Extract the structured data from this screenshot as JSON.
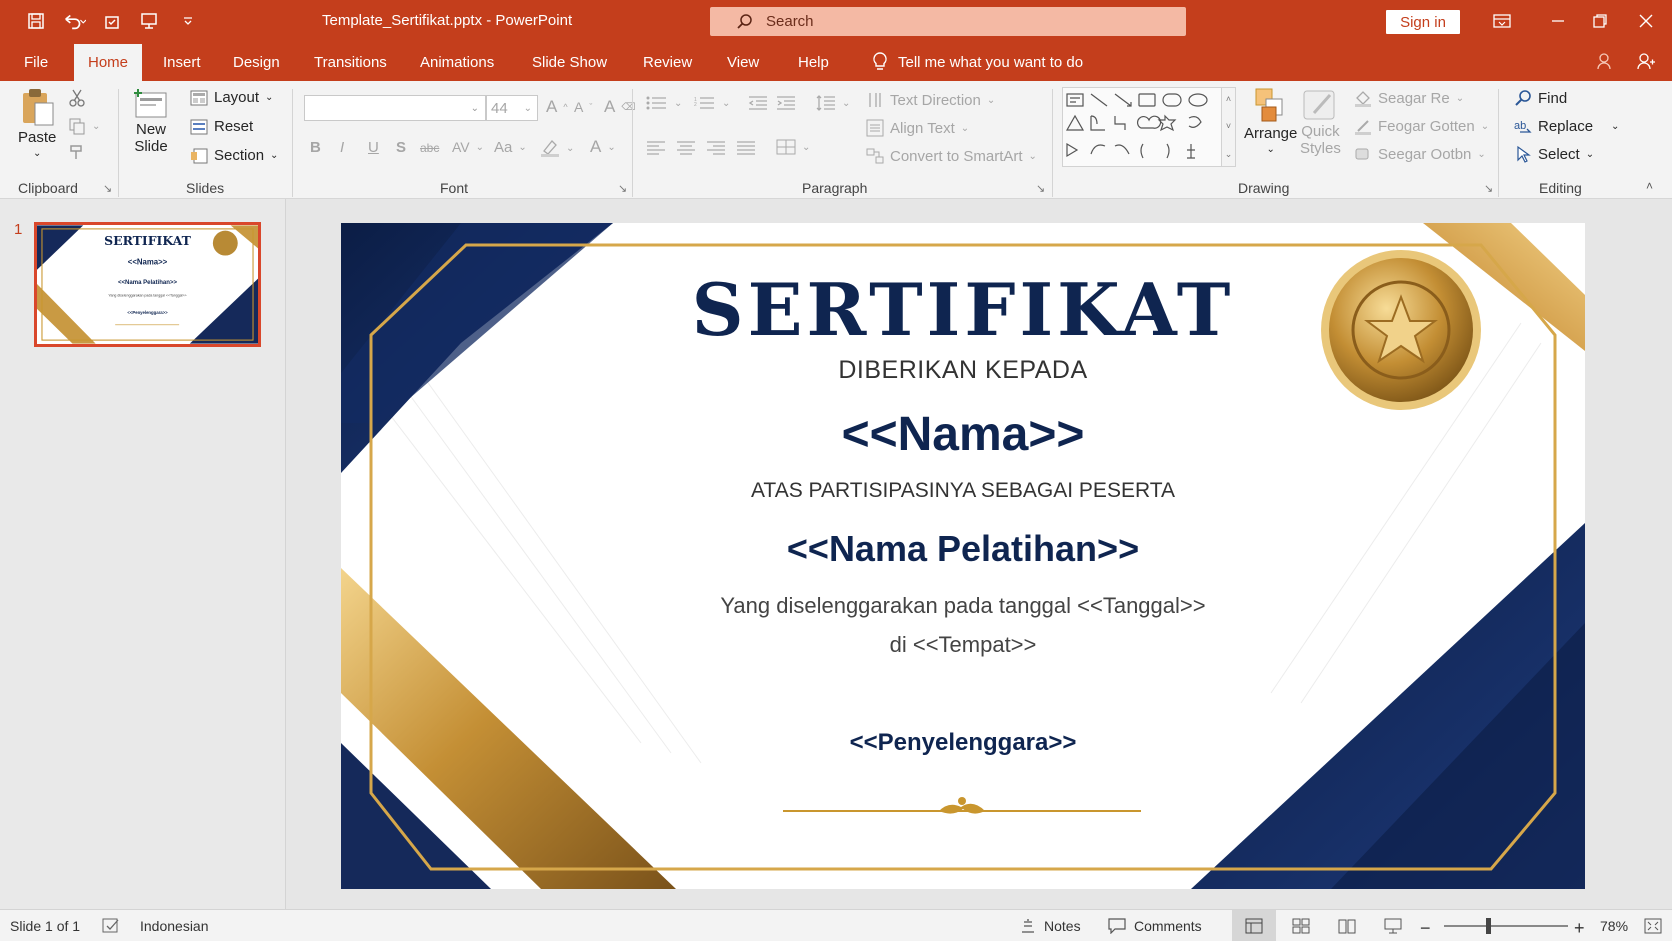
{
  "window": {
    "doc_title": "Template_Sertifikat.pptx  -  PowerPoint",
    "search_placeholder": "Search",
    "signin_label": "Sign in"
  },
  "menu": {
    "tabs": [
      "File",
      "Home",
      "Insert",
      "Design",
      "Transitions",
      "Animations",
      "Slide Show",
      "Review",
      "View",
      "Help"
    ],
    "active_tab": "Home",
    "tell_me": "Tell me what you want to do"
  },
  "ribbon": {
    "clipboard": {
      "paste": "Paste",
      "label": "Clipboard"
    },
    "slides": {
      "new_slide_1": "New",
      "new_slide_2": "Slide",
      "layout": "Layout",
      "reset": "Reset",
      "section": "Section",
      "label": "Slides"
    },
    "font": {
      "font_name": "",
      "font_size": "44",
      "bold": "B",
      "italic": "I",
      "underline": "U",
      "shadow": "S",
      "strike": "abc",
      "spacing": "AV",
      "case": "Aa",
      "label": "Font"
    },
    "paragraph": {
      "text_direction": "Text Direction",
      "align_text": "Align Text",
      "convert_smartart": "Convert to SmartArt",
      "label": "Paragraph"
    },
    "drawing": {
      "arrange": "Arrange",
      "quick_styles_1": "Quick",
      "quick_styles_2": "Styles",
      "shape_fill": "Seagar Re",
      "shape_outline": "Feogar Gotten",
      "shape_effects": "Seegar Ootbn",
      "label": "Drawing"
    },
    "editing": {
      "find": "Find",
      "replace": "Replace",
      "select": "Select",
      "label": "Editing"
    }
  },
  "thumbnails": {
    "slide_number": "1"
  },
  "slide": {
    "title": "SERTIFIKAT",
    "given_to": "DIBERIKAN KEPADA",
    "name": "<<Nama>>",
    "participation": "ATAS PARTISIPASINYA SEBAGAI PESERTA",
    "training": "<<Nama Pelatihan>>",
    "held_on": "Yang diselenggarakan pada tanggal <<Tanggal>>",
    "place": "di <<Tempat>>",
    "organizer": "<<Penyelenggara>>"
  },
  "statusbar": {
    "slide_info": "Slide 1 of 1",
    "language": "Indonesian",
    "notes": "Notes",
    "comments": "Comments",
    "zoom": "78%"
  },
  "colors": {
    "accent": "#c43e1c",
    "navy": "#0f2550",
    "gold": "#c9962e"
  }
}
